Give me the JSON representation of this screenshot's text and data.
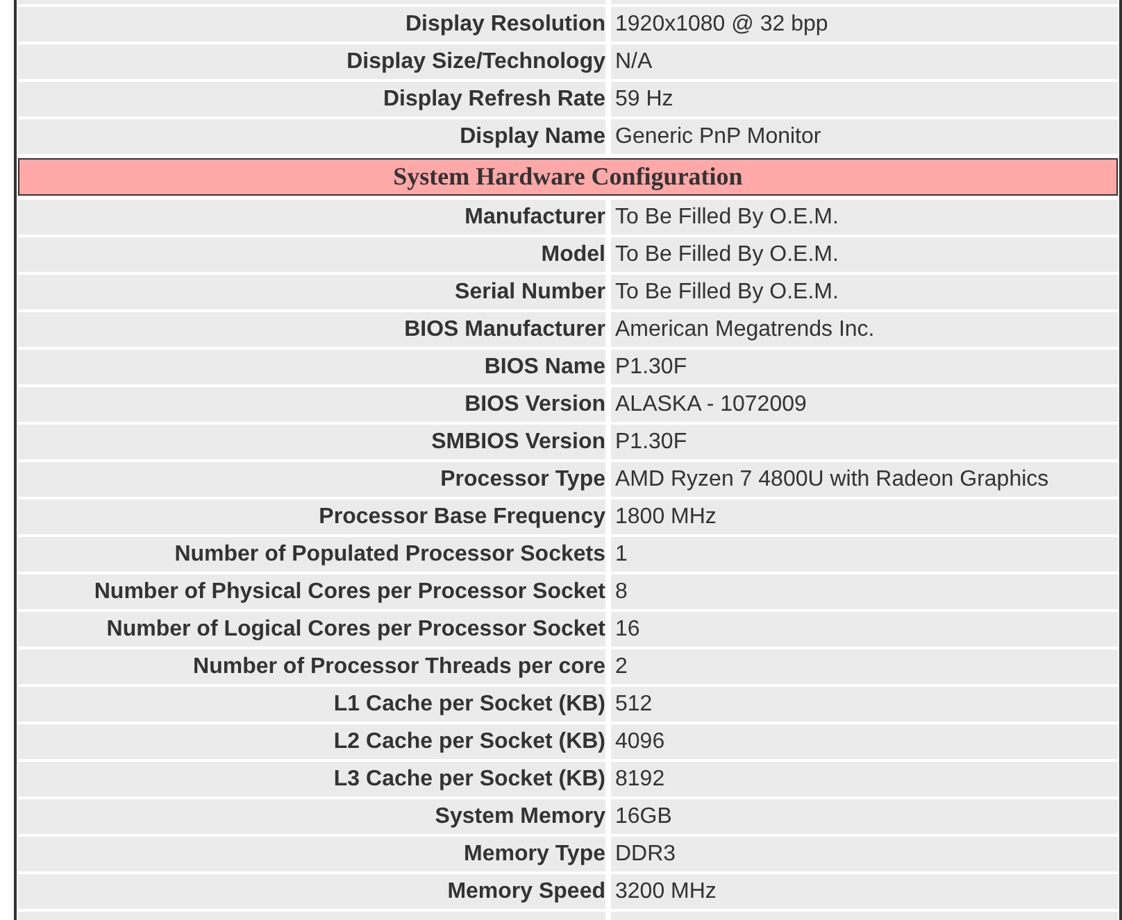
{
  "display_rows": [
    {
      "label": "Display Resolution",
      "value": "1920x1080 @ 32 bpp"
    },
    {
      "label": "Display Size/Technology",
      "value": "N/A"
    },
    {
      "label": "Display Refresh Rate",
      "value": "59 Hz"
    },
    {
      "label": "Display Name",
      "value": "Generic PnP Monitor"
    }
  ],
  "section": {
    "title": "System Hardware Configuration",
    "rows": [
      {
        "label": "Manufacturer",
        "value": "To Be Filled By O.E.M."
      },
      {
        "label": "Model",
        "value": "To Be Filled By O.E.M."
      },
      {
        "label": "Serial Number",
        "value": "To Be Filled By O.E.M."
      },
      {
        "label": "BIOS Manufacturer",
        "value": "American Megatrends Inc."
      },
      {
        "label": "BIOS Name",
        "value": "P1.30F"
      },
      {
        "label": "BIOS Version",
        "value": "ALASKA - 1072009"
      },
      {
        "label": "SMBIOS Version",
        "value": "P1.30F"
      },
      {
        "label": "Processor Type",
        "value": "AMD Ryzen 7 4800U with Radeon Graphics"
      },
      {
        "label": "Processor Base Frequency",
        "value": "1800 MHz"
      },
      {
        "label": "Number of Populated Processor Sockets",
        "value": "1"
      },
      {
        "label": "Number of Physical Cores per Processor Socket",
        "value": "8"
      },
      {
        "label": "Number of Logical Cores per Processor Socket",
        "value": "16"
      },
      {
        "label": "Number of Processor Threads per core",
        "value": "2"
      },
      {
        "label": "L1 Cache per Socket (KB)",
        "value": "512"
      },
      {
        "label": "L2 Cache per Socket (KB)",
        "value": "4096"
      },
      {
        "label": "L3 Cache per Socket (KB)",
        "value": "8192"
      },
      {
        "label": "System Memory",
        "value": "16GB"
      },
      {
        "label": "Memory Type",
        "value": "DDR3"
      },
      {
        "label": "Memory Speed",
        "value": "3200 MHz"
      }
    ]
  }
}
